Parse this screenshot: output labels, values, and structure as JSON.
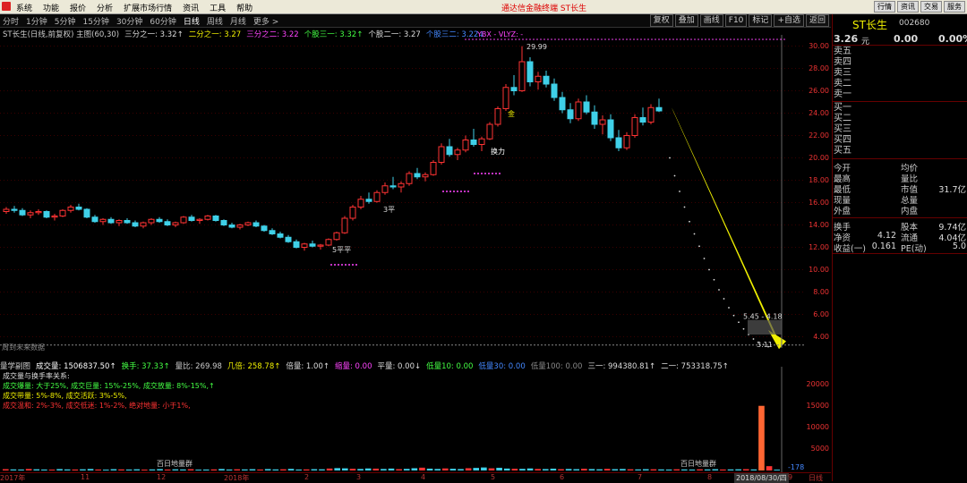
{
  "menu": {
    "items": [
      "系统",
      "功能",
      "报价",
      "分析",
      "扩展市场行情",
      "资讯",
      "工具",
      "帮助"
    ],
    "app_title": "通达信金融终端   ST长生",
    "window_buttons": [
      "行情",
      "资讯",
      "交易",
      "服务"
    ]
  },
  "periods": [
    "分时",
    "1分钟",
    "5分钟",
    "15分钟",
    "30分钟",
    "60分钟",
    "日线",
    "周线",
    "月线",
    "更多 >"
  ],
  "active_period": "日线",
  "toolbar": [
    "复权",
    "叠加",
    "画线",
    "F10",
    "标记",
    "+自选",
    "返回"
  ],
  "main_legend": [
    {
      "text": "ST长生(日线,前复权) 主图(60,30)",
      "color": "#cccccc"
    },
    {
      "text": "三分之一: 3.32↑",
      "color": "#dddddd"
    },
    {
      "text": "二分之一: 3.27",
      "color": "#f0f000"
    },
    {
      "text": "三分之二: 3.22",
      "color": "#ff44ff"
    },
    {
      "text": "个股三一: 3.32↑",
      "color": "#44ff44"
    },
    {
      "text": "个股二一: 3.27",
      "color": "#dddddd"
    },
    {
      "text": "个股三二: 3.22↓",
      "color": "#4488ff"
    }
  ],
  "annotations": {
    "high": "29.99",
    "low": "3.11",
    "range": "5.45 - 4.18",
    "tag_huanlao": "换力",
    "tag_jin": "金",
    "tag_ping3": "3平",
    "tag_ping": "5平平",
    "future": "周到未来数据",
    "ybs": "YBX - VLYZ: -"
  },
  "price_axis": {
    "ticks": [
      "30.00",
      "28.00",
      "26.00",
      "24.00",
      "22.00",
      "20.00",
      "18.00",
      "16.00",
      "14.00",
      "12.00",
      "10.00",
      "8.00",
      "6.00",
      "4.00"
    ]
  },
  "chart_data": {
    "type": "candlestick",
    "title": "ST长生(日线,前复权)",
    "ylim": [
      3.0,
      31.0
    ],
    "ohlc": [
      [
        15.2,
        15.6,
        15.0,
        15.4
      ],
      [
        15.4,
        15.7,
        15.1,
        15.3
      ],
      [
        15.3,
        15.5,
        14.8,
        14.9
      ],
      [
        14.9,
        15.3,
        14.6,
        15.1
      ],
      [
        15.1,
        15.4,
        14.9,
        15.2
      ],
      [
        15.2,
        15.3,
        14.6,
        14.7
      ],
      [
        14.7,
        15.0,
        14.4,
        14.8
      ],
      [
        14.8,
        15.4,
        14.7,
        15.3
      ],
      [
        15.3,
        15.8,
        15.1,
        15.6
      ],
      [
        15.6,
        15.9,
        15.3,
        15.4
      ],
      [
        15.4,
        15.5,
        14.6,
        14.7
      ],
      [
        14.7,
        14.9,
        14.2,
        14.3
      ],
      [
        14.3,
        14.6,
        14.0,
        14.5
      ],
      [
        14.5,
        14.7,
        14.1,
        14.2
      ],
      [
        14.2,
        14.5,
        13.9,
        14.4
      ],
      [
        14.4,
        14.6,
        14.1,
        14.2
      ],
      [
        14.2,
        14.4,
        13.8,
        13.9
      ],
      [
        13.9,
        14.3,
        13.7,
        14.2
      ],
      [
        14.2,
        14.6,
        14.0,
        14.5
      ],
      [
        14.5,
        14.7,
        14.2,
        14.3
      ],
      [
        14.3,
        14.5,
        13.9,
        14.0
      ],
      [
        14.0,
        14.3,
        13.8,
        14.2
      ],
      [
        14.2,
        14.8,
        14.1,
        14.7
      ],
      [
        14.7,
        14.9,
        14.3,
        14.4
      ],
      [
        14.4,
        14.6,
        14.1,
        14.5
      ],
      [
        14.5,
        14.9,
        14.4,
        14.8
      ],
      [
        14.8,
        14.9,
        14.3,
        14.4
      ],
      [
        14.4,
        14.5,
        13.9,
        14.0
      ],
      [
        14.0,
        14.2,
        13.7,
        13.8
      ],
      [
        13.8,
        14.1,
        13.6,
        14.0
      ],
      [
        14.0,
        14.3,
        13.9,
        14.2
      ],
      [
        14.2,
        14.4,
        13.8,
        13.9
      ],
      [
        13.9,
        14.0,
        13.4,
        13.5
      ],
      [
        13.5,
        13.7,
        13.1,
        13.2
      ],
      [
        13.2,
        13.4,
        12.8,
        12.9
      ],
      [
        12.9,
        13.1,
        12.4,
        12.5
      ],
      [
        12.5,
        12.7,
        11.9,
        12.0
      ],
      [
        12.0,
        12.4,
        11.7,
        12.3
      ],
      [
        12.3,
        12.6,
        12.0,
        12.1
      ],
      [
        12.1,
        12.3,
        11.8,
        12.2
      ],
      [
        12.2,
        12.8,
        12.1,
        12.7
      ],
      [
        12.7,
        13.4,
        12.6,
        13.3
      ],
      [
        13.3,
        14.8,
        13.2,
        14.6
      ],
      [
        14.6,
        15.8,
        14.4,
        15.6
      ],
      [
        15.6,
        16.6,
        15.4,
        16.3
      ],
      [
        16.3,
        16.9,
        15.9,
        16.1
      ],
      [
        16.1,
        17.1,
        16.0,
        16.9
      ],
      [
        16.9,
        17.8,
        16.7,
        17.5
      ],
      [
        17.5,
        18.3,
        17.2,
        17.4
      ],
      [
        17.4,
        17.9,
        16.9,
        17.7
      ],
      [
        17.7,
        18.8,
        17.5,
        18.6
      ],
      [
        18.6,
        19.1,
        18.1,
        18.3
      ],
      [
        18.3,
        18.7,
        17.9,
        18.5
      ],
      [
        18.5,
        19.8,
        18.4,
        19.6
      ],
      [
        19.6,
        21.3,
        19.4,
        21.0
      ],
      [
        21.0,
        21.7,
        20.1,
        20.3
      ],
      [
        20.3,
        20.9,
        19.8,
        20.7
      ],
      [
        20.7,
        22.0,
        20.5,
        21.6
      ],
      [
        21.6,
        22.6,
        21.0,
        21.2
      ],
      [
        21.2,
        21.9,
        20.6,
        21.7
      ],
      [
        21.7,
        23.2,
        21.6,
        23.0
      ],
      [
        23.0,
        24.6,
        22.8,
        24.4
      ],
      [
        24.4,
        26.6,
        24.2,
        26.3
      ],
      [
        26.3,
        27.4,
        25.6,
        26.0
      ],
      [
        26.0,
        29.99,
        25.9,
        28.6
      ],
      [
        28.6,
        29.0,
        26.4,
        26.8
      ],
      [
        26.8,
        27.7,
        26.1,
        27.3
      ],
      [
        27.3,
        27.8,
        26.3,
        26.6
      ],
      [
        26.6,
        27.1,
        25.1,
        25.4
      ],
      [
        25.4,
        25.9,
        24.0,
        24.3
      ],
      [
        24.3,
        24.9,
        23.1,
        23.5
      ],
      [
        23.5,
        25.3,
        23.3,
        25.0
      ],
      [
        25.0,
        25.6,
        23.9,
        24.1
      ],
      [
        24.1,
        24.7,
        22.6,
        23.0
      ],
      [
        23.0,
        23.8,
        22.1,
        23.4
      ],
      [
        23.4,
        23.9,
        21.5,
        21.8
      ],
      [
        21.8,
        22.5,
        20.6,
        20.9
      ],
      [
        20.9,
        22.3,
        20.7,
        22.0
      ],
      [
        22.0,
        23.9,
        21.8,
        23.6
      ],
      [
        23.6,
        24.5,
        22.9,
        23.2
      ],
      [
        23.2,
        24.8,
        23.0,
        24.5
      ],
      [
        24.5,
        25.3,
        24.1,
        24.2
      ]
    ],
    "forecast_tail": [
      20.0,
      18.4,
      17.0,
      15.6,
      14.3,
      13.2,
      12.1,
      11.0,
      10.0,
      9.1,
      8.2,
      7.4,
      6.6,
      5.9,
      5.3,
      4.7,
      4.2,
      3.8,
      3.5,
      3.3,
      3.11
    ],
    "volume": {
      "title": "量学副图",
      "values": [
        12,
        10,
        9,
        14,
        11,
        9,
        8,
        13,
        10,
        9,
        11,
        14,
        9,
        8,
        12,
        10,
        9,
        11,
        8,
        10,
        13,
        9,
        11,
        10,
        12,
        8,
        9,
        10,
        14,
        9,
        11,
        10,
        12,
        9,
        13,
        10,
        11,
        15,
        9,
        10,
        12,
        11,
        18,
        22,
        20,
        16,
        14,
        19,
        17,
        14,
        18,
        12,
        15,
        21,
        26,
        17,
        14,
        19,
        16,
        13,
        21,
        24,
        28,
        20,
        25,
        18,
        16,
        15,
        19,
        14,
        13,
        17,
        12,
        14,
        12,
        16,
        13,
        11,
        15,
        12,
        14,
        11,
        10,
        12,
        11,
        10,
        9,
        11,
        10,
        9,
        11,
        10,
        12,
        9,
        10,
        11,
        12,
        10,
        15000,
        1000,
        200
      ],
      "ylim": [
        0,
        22000
      ],
      "ticks": [
        "20000",
        "15000",
        "10000",
        "5000"
      ]
    }
  },
  "sub_legend": [
    {
      "text": "量学副图",
      "color": "#cccccc"
    },
    {
      "text": "成交量: 1506837.50↑",
      "color": "#ffffff"
    },
    {
      "text": "换手: 37.33↑",
      "color": "#44ff44"
    },
    {
      "text": "量比: 269.98",
      "color": "#cccccc"
    },
    {
      "text": "几倍: 258.78↑",
      "color": "#f0f000"
    },
    {
      "text": "倍量: 1.00↑",
      "color": "#dddddd"
    },
    {
      "text": "缩量: 0.00",
      "color": "#ff44ff"
    },
    {
      "text": "平量: 0.00↓",
      "color": "#dddddd"
    },
    {
      "text": "低量10: 0.00",
      "color": "#44ff44"
    },
    {
      "text": "低量30: 0.00",
      "color": "#4488ff"
    },
    {
      "text": "低量100: 0.00",
      "color": "#888888"
    },
    {
      "text": "三一: 994380.81↑",
      "color": "#dddddd"
    },
    {
      "text": "二一: 753318.75↑",
      "color": "#dddddd"
    }
  ],
  "notes": [
    {
      "text": "成交量与换手率关系:",
      "color": "#dddddd"
    },
    {
      "text": "成交爆量: 大于25%, 成交巨量: 15%-25%, 成交放量: 8%-15%,↑",
      "color": "#44ff44"
    },
    {
      "text": "成交带量: 5%-8%, 成交活跃: 3%-5%,",
      "color": "#f0f000"
    },
    {
      "text": "成交温和: 2%-3%, 成交低迷: 1%-2%, 绝对地量: 小于1%,",
      "color": "#ff3333"
    }
  ],
  "sub_labels": {
    "left": "百日地量群",
    "right": "百日地量群",
    "neg": "-178"
  },
  "date_axis": [
    "2017年",
    "11",
    "12",
    "2018年",
    "2",
    "3",
    "4",
    "5",
    "6",
    "7",
    "8",
    "2018/08/30/四",
    "9",
    "日线"
  ],
  "quote_panel": {
    "name": "ST长生",
    "code": "002680",
    "price": "3.26",
    "price_unit": "元",
    "change": "0.00",
    "change_pct": "0.00%",
    "sell_levels": [
      "卖五",
      "卖四",
      "卖三",
      "卖二",
      "卖一"
    ],
    "buy_levels": [
      "买一",
      "买二",
      "买三",
      "买四",
      "买五"
    ],
    "stats": [
      {
        "l": "今开",
        "lv": "",
        "r": "均价",
        "rv": ""
      },
      {
        "l": "最高",
        "lv": "",
        "r": "量比",
        "rv": ""
      },
      {
        "l": "最低",
        "lv": "",
        "r": "市值",
        "rv": "31.7亿"
      },
      {
        "l": "现量",
        "lv": "",
        "r": "总量",
        "rv": ""
      },
      {
        "l": "外盘",
        "lv": "",
        "r": "内盘",
        "rv": ""
      }
    ],
    "stats2": [
      {
        "l": "换手",
        "lv": "",
        "r": "股本",
        "rv": "9.74亿"
      },
      {
        "l": "净资",
        "lv": "4.12",
        "r": "流通",
        "rv": "4.04亿"
      },
      {
        "l": "收益(一)",
        "lv": "0.161",
        "r": "PE(动)",
        "rv": "5.0"
      }
    ]
  },
  "colors": {
    "up": "#ff3333",
    "down": "#3fd0e8",
    "yellow": "#f0f000",
    "magenta": "#ff44ff",
    "axis": "#e33333"
  }
}
